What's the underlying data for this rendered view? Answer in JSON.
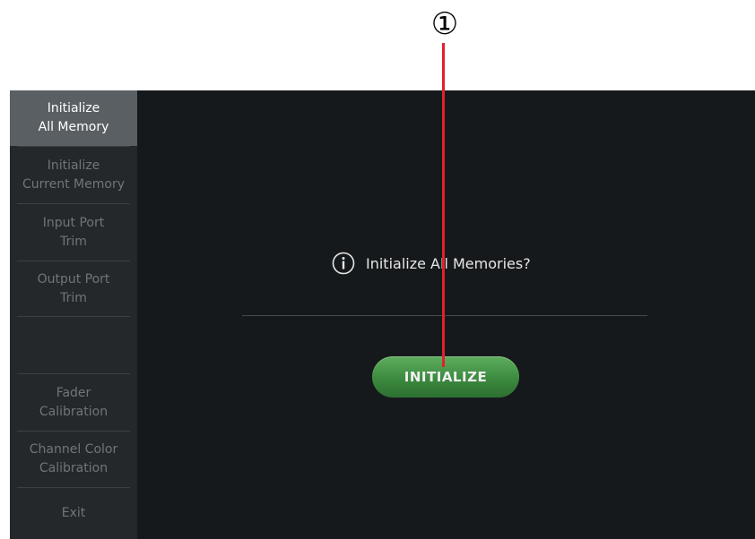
{
  "callout": {
    "number": "①"
  },
  "sidebar": {
    "items": [
      {
        "label": "Initialize\nAll Memory",
        "active": true
      },
      {
        "label": "Initialize\nCurrent Memory",
        "active": false
      },
      {
        "label": "Input Port\nTrim",
        "active": false
      },
      {
        "label": "Output Port\nTrim",
        "active": false
      },
      {
        "label": "Fader\nCalibration",
        "active": false
      },
      {
        "label": "Channel Color\nCalibration",
        "active": false
      },
      {
        "label": "Exit",
        "active": false
      }
    ]
  },
  "main": {
    "message_icon": "info-icon",
    "message": "Initialize All Memories?",
    "button_label": "INITIALIZE"
  },
  "colors": {
    "screen_background": "#16191b",
    "sidebar_background": "#24282b",
    "active_item": "#595f63",
    "button_green": "#3e8d41",
    "callout_line": "#e0212e"
  }
}
